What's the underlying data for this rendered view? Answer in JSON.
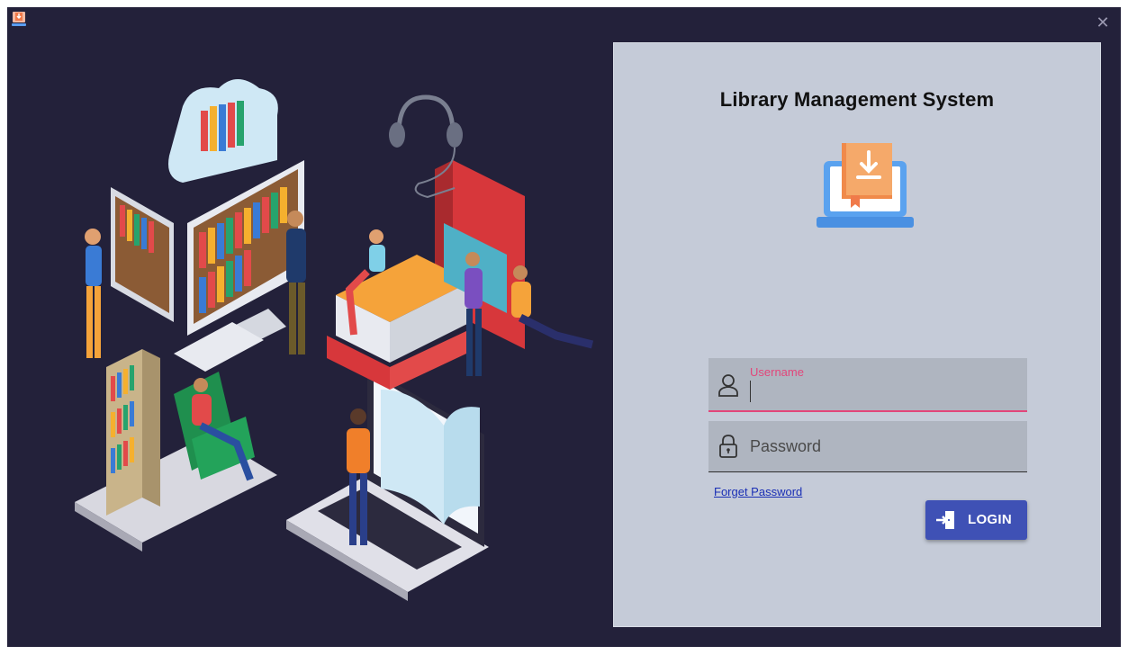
{
  "window": {
    "app_icon": "library-app-icon",
    "close_icon": "close-icon",
    "close_glyph": "✕"
  },
  "illustration": {
    "icon": "library-illustration"
  },
  "login": {
    "title": "Library Management System",
    "logo_icon": "laptop-download-book-icon",
    "username": {
      "label": "Username",
      "value": "",
      "icon": "user-icon"
    },
    "password": {
      "placeholder": "Password",
      "value": "",
      "icon": "lock-icon"
    },
    "forget_password": "Forget Password",
    "login_button": {
      "label": "LOGIN",
      "icon": "sign-in-icon"
    }
  },
  "colors": {
    "window_bg": "#23213a",
    "panel_bg": "#c5cbd8",
    "field_bg": "#afb5c0",
    "accent_pink": "#e2467a",
    "button": "#3f51b5",
    "link": "#1a2fb5"
  }
}
